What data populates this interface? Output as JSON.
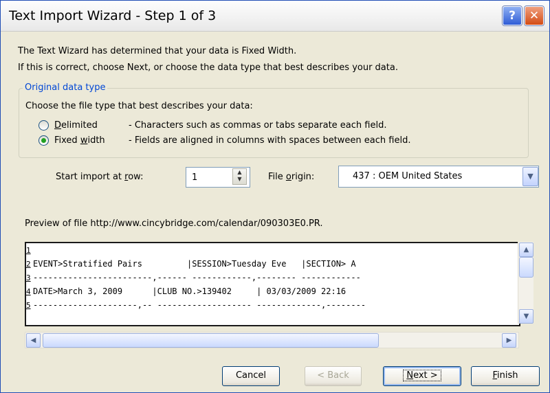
{
  "window": {
    "title": "Text Import Wizard - Step 1 of 3"
  },
  "intro": {
    "line1": "The Text Wizard has determined that your data is Fixed Width.",
    "line2": "If this is correct, choose Next, or choose the data type that best describes your data."
  },
  "original_type": {
    "legend": "Original data type",
    "prompt": "Choose the file type that best describes your data:",
    "options": [
      {
        "pre": "",
        "key": "D",
        "post": "elimited",
        "desc": "- Characters such as commas or tabs separate each field.",
        "selected": false
      },
      {
        "pre": "Fixed ",
        "key": "w",
        "post": "idth",
        "desc": "- Fields are aligned in columns with spaces between each field.",
        "selected": true
      }
    ]
  },
  "start_row": {
    "pre": "Start import at ",
    "key": "r",
    "post": "ow:",
    "value": "1"
  },
  "file_origin": {
    "pre": "File ",
    "key": "o",
    "post": "rigin:",
    "value": "437 : OEM United States"
  },
  "preview": {
    "label": "Preview of file http://www.cincybridge.com/calendar/090303E0.PR.",
    "rows": [
      {
        "num": "1",
        "text": ""
      },
      {
        "num": "2",
        "text": "EVENT>Stratified Pairs         |SESSION>Tuesday Eve   |SECTION> A"
      },
      {
        "num": "3",
        "text": "------------------------,------ ------------,-------- ------------"
      },
      {
        "num": "4",
        "text": "DATE>March 3, 2009      |CLUB NO.>139402     | 03/03/2009 22:16"
      },
      {
        "num": "5",
        "text": "---------------------,-- ------------------- -------------,--------"
      }
    ]
  },
  "buttons": {
    "cancel": "Cancel",
    "back": "< Back",
    "next": {
      "key": "N",
      "post": "ext >"
    },
    "finish": {
      "key": "F",
      "post": "inish"
    }
  }
}
